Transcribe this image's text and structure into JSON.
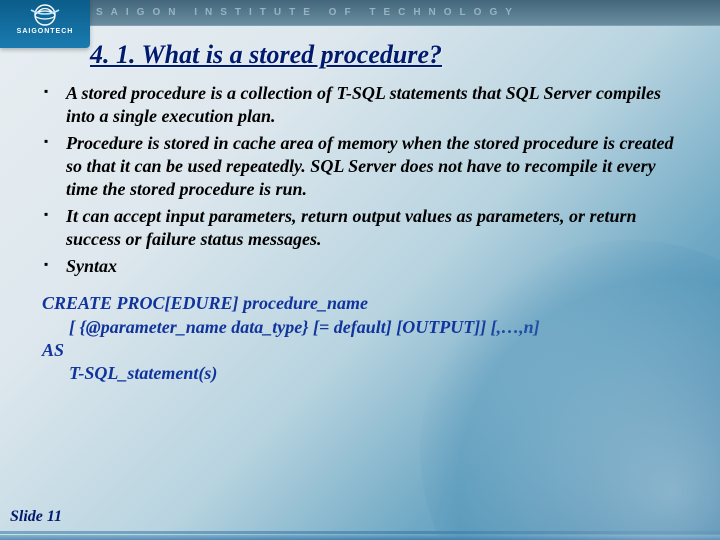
{
  "header": {
    "institute": "SAIGON INSTITUTE OF TECHNOLOGY",
    "logo_label": "SAIGONTECH"
  },
  "title": "4. 1. What is a stored procedure?",
  "bullets": [
    "A stored procedure is a collection of T-SQL statements that SQL Server compiles into a single execution plan.",
    "Procedure is stored in cache area of memory when the stored procedure is created so that it can be used repeatedly. SQL Server does not have to recompile it every time the stored procedure is run.",
    "It can accept input parameters, return output values as parameters, or return success or failure status messages.",
    "Syntax"
  ],
  "syntax_lines": [
    "CREATE PROC[EDURE] procedure_name",
    "      [ {@parameter_name data_type} [= default] [OUTPUT]] [,…,n]",
    "AS",
    "      T-SQL_statement(s)"
  ],
  "slide_label": "Slide 11"
}
